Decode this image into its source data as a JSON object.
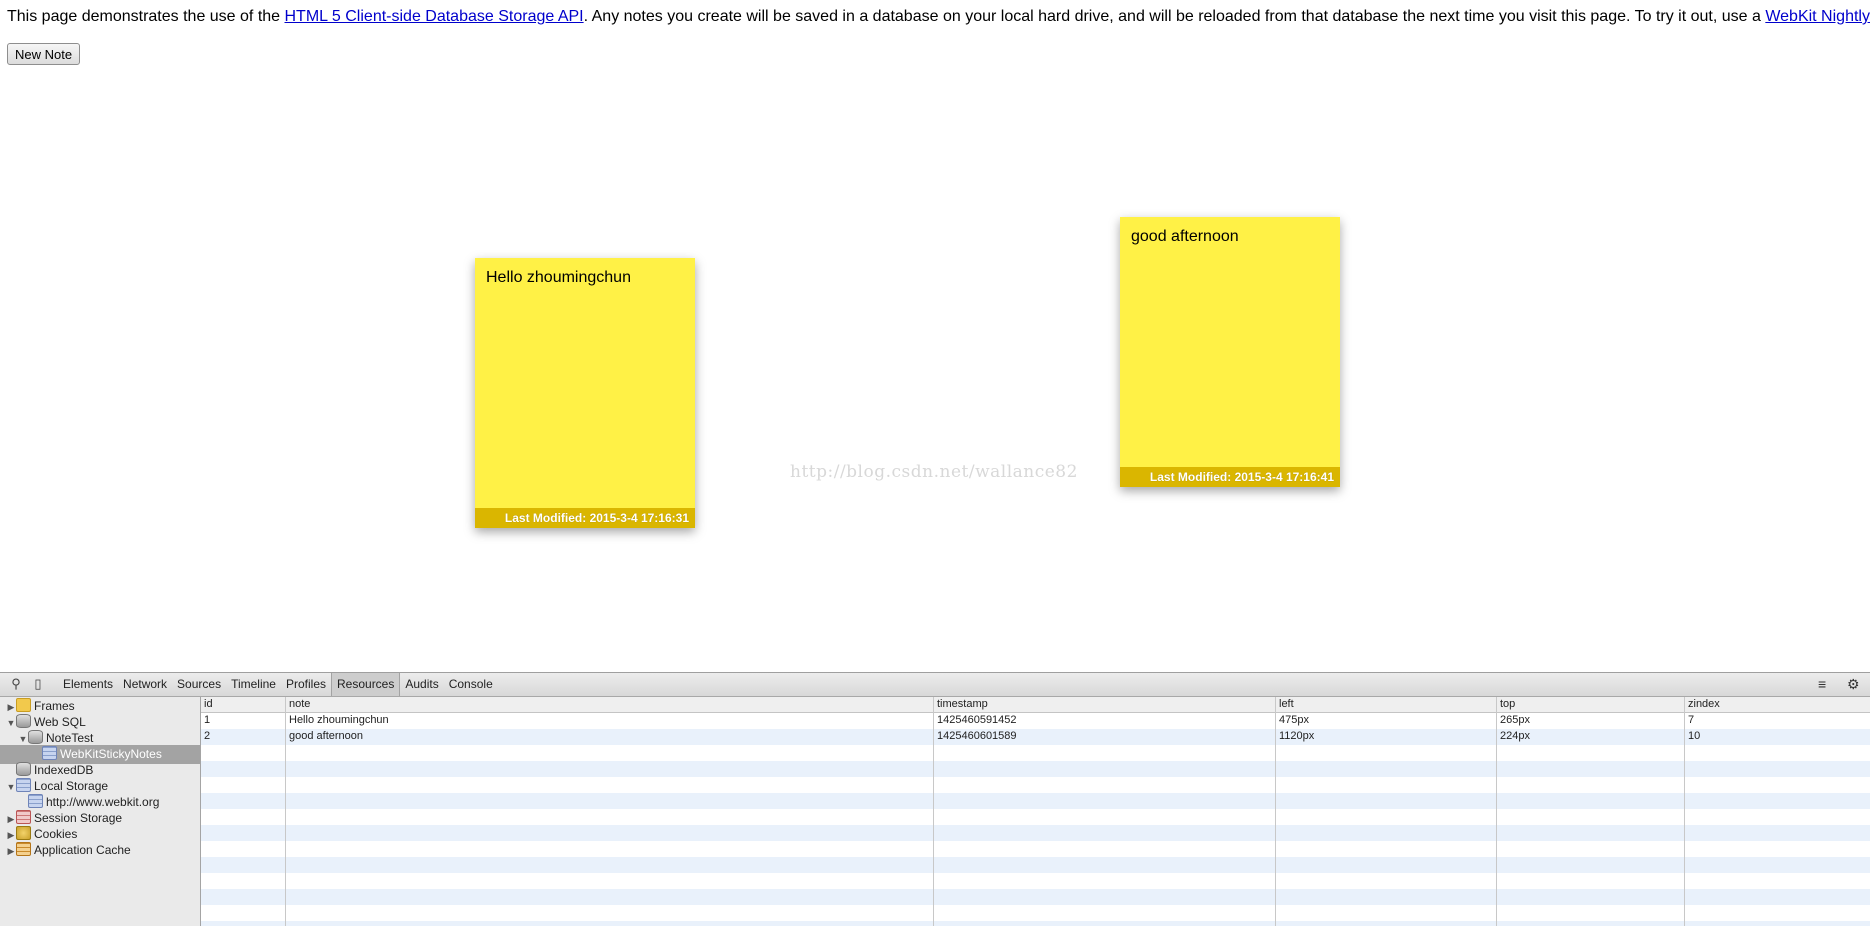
{
  "intro": {
    "before_link1": "This page demonstrates the use of the ",
    "link1": "HTML 5 Client-side Database Storage API",
    "middle": ". Any notes you create will be saved in a database on your local hard drive, and will be reloaded from that database the next time you visit this page. To try it out, use a ",
    "link2": "WebKit Nightly Build",
    "after_link2": "."
  },
  "new_note_label": "New Note",
  "notes": [
    {
      "text": "Hello zhoumingchun",
      "footer": "Last Modified: 2015-3-4 17:16:31"
    },
    {
      "text": "good afternoon",
      "footer": "Last Modified: 2015-3-4 17:16:41"
    }
  ],
  "watermark": "http://blog.csdn.net/wallance82",
  "devtools": {
    "tabs": [
      "Elements",
      "Network",
      "Sources",
      "Timeline",
      "Profiles",
      "Resources",
      "Audits",
      "Console"
    ],
    "active_tab": "Resources",
    "tree": {
      "frames": "Frames",
      "web_sql": "Web SQL",
      "notetest": "NoteTest",
      "webkitstickynotes": "WebKitStickyNotes",
      "indexeddb": "IndexedDB",
      "local_storage": "Local Storage",
      "local_storage_origin": "http://www.webkit.org",
      "session_storage": "Session Storage",
      "cookies": "Cookies",
      "app_cache": "Application Cache"
    },
    "columns": [
      "id",
      "note",
      "timestamp",
      "left",
      "top",
      "zindex"
    ],
    "rows": [
      [
        "1",
        "Hello zhoumingchun",
        "1425460591452",
        "475px",
        "265px",
        "7"
      ],
      [
        "2",
        "good afternoon",
        "1425460601589",
        "1120px",
        "224px",
        "10"
      ]
    ]
  }
}
